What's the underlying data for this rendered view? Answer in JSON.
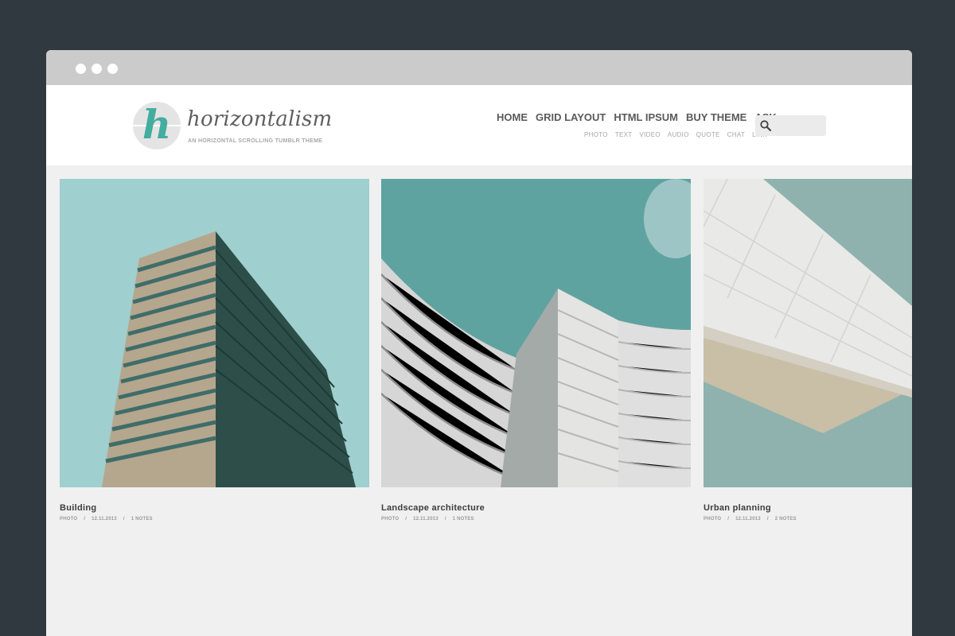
{
  "header": {
    "logo_letter": "h",
    "site_name": "horizontalism",
    "tagline": "AN HORIZONTAL SCROLLING TUMBLR THEME"
  },
  "nav": {
    "items": [
      "HOME",
      "GRID LAYOUT",
      "HTML IPSUM",
      "BUY THEME",
      "ASK"
    ]
  },
  "subnav": {
    "items": [
      "PHOTO",
      "TEXT",
      "VIDEO",
      "AUDIO",
      "QUOTE",
      "CHAT",
      "LINK"
    ]
  },
  "search": {
    "icon": "search-icon",
    "value": "",
    "placeholder": ""
  },
  "posts": [
    {
      "title": "Building",
      "type": "PHOTO",
      "sep": "/",
      "date": "12.11.2013",
      "notes": "1 NOTES"
    },
    {
      "title": "Landscape architecture",
      "type": "PHOTO",
      "sep": "/",
      "date": "12.11.2013",
      "notes": "1 NOTES"
    },
    {
      "title": "Urban planning",
      "type": "PHOTO",
      "sep": "/",
      "date": "12.11.2013",
      "notes": "2 NOTES"
    }
  ],
  "colors": {
    "page_bg": "#2f393f",
    "accent": "#43ada0",
    "browser_chrome": "#cbcbcb",
    "content_bg": "#f0f0f0"
  }
}
